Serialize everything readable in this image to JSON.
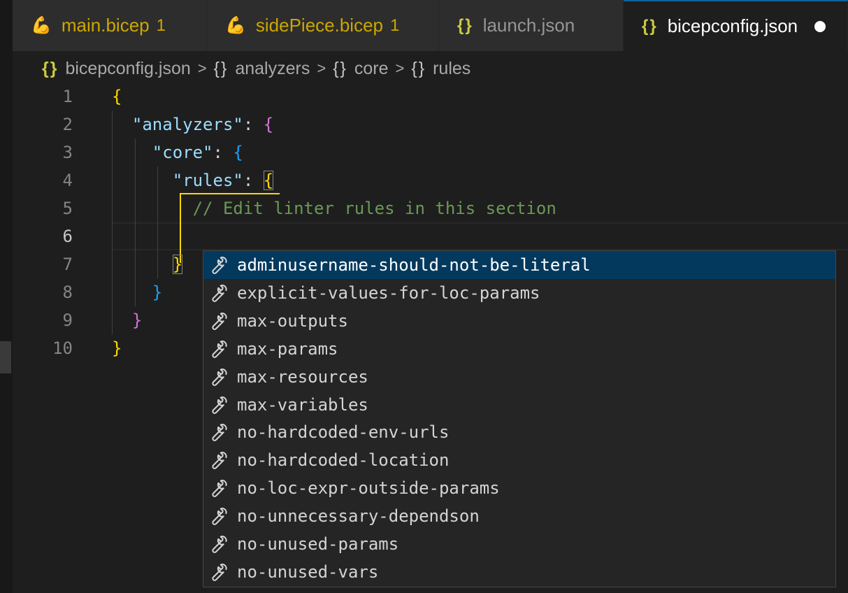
{
  "tabs": [
    {
      "name": "main.bicep",
      "icon": "bicep-icon",
      "badge": "1",
      "warning": true,
      "active": false
    },
    {
      "name": "sidePiece.bicep",
      "icon": "bicep-icon",
      "badge": "1",
      "warning": true,
      "active": false
    },
    {
      "name": "launch.json",
      "icon": "json-icon",
      "badge": "",
      "warning": false,
      "active": false
    },
    {
      "name": "bicepconfig.json",
      "icon": "json-icon",
      "badge": "",
      "warning": false,
      "active": true,
      "unsaved": true
    }
  ],
  "json_icon_glyph": "{}",
  "bicep_icon_glyph": "💪",
  "breadcrumb": {
    "separator": ">",
    "items": [
      "bicepconfig.json",
      "analyzers",
      "core",
      "rules"
    ]
  },
  "editor": {
    "line_numbers": [
      "1",
      "2",
      "3",
      "4",
      "5",
      "6",
      "7",
      "8",
      "9",
      "10"
    ],
    "current_line": "6",
    "lines": {
      "l1_open": "{",
      "l2_key": "\"analyzers\"",
      "l2_colon": ": ",
      "l2_open": "{",
      "l3_key": "\"core\"",
      "l3_colon": ": ",
      "l3_open": "{",
      "l4_key": "\"rules\"",
      "l4_colon": ": ",
      "l4_open": "{",
      "l5_comment": "// Edit linter rules in this section",
      "l7_close": "}",
      "l8_close": "}",
      "l9_close": "}",
      "l10_close": "}"
    }
  },
  "suggestions": [
    "adminusername-should-not-be-literal",
    "explicit-values-for-loc-params",
    "max-outputs",
    "max-params",
    "max-resources",
    "max-variables",
    "no-hardcoded-env-urls",
    "no-hardcoded-location",
    "no-loc-expr-outside-params",
    "no-unnecessary-dependson",
    "no-unused-params",
    "no-unused-vars"
  ],
  "suggestion_selected_index": 0,
  "suggestion_icon": "wrench-icon",
  "colors": {
    "bracket_level1": "#ffd700",
    "bracket_level2": "#da70d6",
    "bracket_level3": "#179fff",
    "key": "#9cdcfe",
    "comment": "#6a9955",
    "selected_suggestion_bg": "#04395e",
    "warning": "#cca700"
  }
}
